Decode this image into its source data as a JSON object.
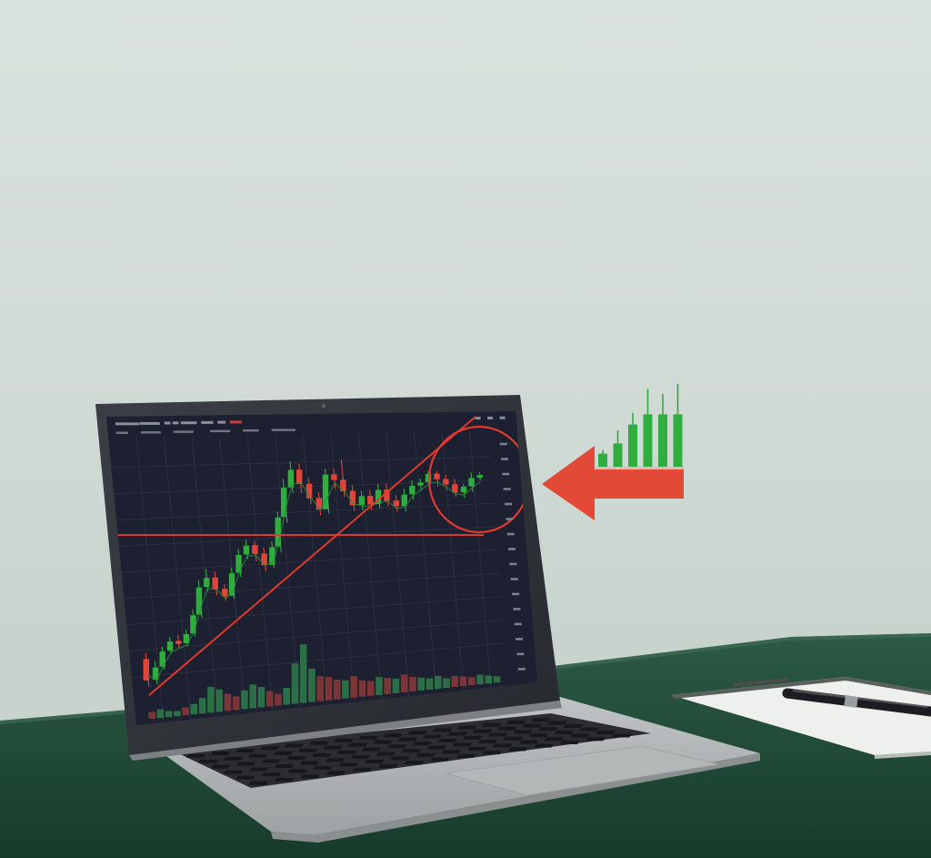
{
  "scene": {
    "wall_color": "#d4ddd7",
    "desk_color": "#1f4a36",
    "laptop_color": "#a9adae",
    "screen_bg": "#1e2231"
  },
  "chart_data": {
    "type": "candlestick",
    "up_color": "#2fae3f",
    "down_color": "#e0453a",
    "annotation_color": "#e03a2e",
    "candles": [
      {
        "o": 36,
        "c": 22,
        "h": 40,
        "l": 18
      },
      {
        "o": 22,
        "c": 30,
        "h": 34,
        "l": 19
      },
      {
        "o": 30,
        "c": 40,
        "h": 43,
        "l": 28
      },
      {
        "o": 40,
        "c": 46,
        "h": 49,
        "l": 38
      },
      {
        "o": 46,
        "c": 44,
        "h": 50,
        "l": 41
      },
      {
        "o": 44,
        "c": 50,
        "h": 53,
        "l": 42
      },
      {
        "o": 50,
        "c": 62,
        "h": 66,
        "l": 48
      },
      {
        "o": 62,
        "c": 80,
        "h": 85,
        "l": 60
      },
      {
        "o": 80,
        "c": 86,
        "h": 92,
        "l": 77
      },
      {
        "o": 86,
        "c": 78,
        "h": 90,
        "l": 74
      },
      {
        "o": 78,
        "c": 73,
        "h": 81,
        "l": 70
      },
      {
        "o": 73,
        "c": 88,
        "h": 92,
        "l": 71
      },
      {
        "o": 88,
        "c": 100,
        "h": 104,
        "l": 85
      },
      {
        "o": 100,
        "c": 106,
        "h": 110,
        "l": 97
      },
      {
        "o": 106,
        "c": 100,
        "h": 109,
        "l": 95
      },
      {
        "o": 100,
        "c": 92,
        "h": 104,
        "l": 88
      },
      {
        "o": 92,
        "c": 104,
        "h": 108,
        "l": 90
      },
      {
        "o": 104,
        "c": 124,
        "h": 128,
        "l": 100
      },
      {
        "o": 124,
        "c": 144,
        "h": 150,
        "l": 120
      },
      {
        "o": 144,
        "c": 156,
        "h": 162,
        "l": 140
      },
      {
        "o": 156,
        "c": 146,
        "h": 160,
        "l": 140
      },
      {
        "o": 146,
        "c": 136,
        "h": 150,
        "l": 132
      },
      {
        "o": 136,
        "c": 128,
        "h": 140,
        "l": 124
      },
      {
        "o": 128,
        "c": 152,
        "h": 156,
        "l": 125
      },
      {
        "o": 152,
        "c": 148,
        "h": 156,
        "l": 142
      },
      {
        "o": 148,
        "c": 140,
        "h": 162,
        "l": 136
      },
      {
        "o": 140,
        "c": 130,
        "h": 144,
        "l": 126
      },
      {
        "o": 130,
        "c": 136,
        "h": 140,
        "l": 126
      },
      {
        "o": 136,
        "c": 130,
        "h": 140,
        "l": 126
      },
      {
        "o": 130,
        "c": 140,
        "h": 144,
        "l": 127
      },
      {
        "o": 140,
        "c": 132,
        "h": 144,
        "l": 128
      },
      {
        "o": 132,
        "c": 128,
        "h": 136,
        "l": 124
      },
      {
        "o": 128,
        "c": 136,
        "h": 140,
        "l": 124
      },
      {
        "o": 136,
        "c": 142,
        "h": 146,
        "l": 132
      },
      {
        "o": 142,
        "c": 144,
        "h": 147,
        "l": 138
      },
      {
        "o": 144,
        "c": 150,
        "h": 152,
        "l": 140
      },
      {
        "o": 150,
        "c": 146,
        "h": 152,
        "l": 141
      },
      {
        "o": 146,
        "c": 142,
        "h": 149,
        "l": 138
      },
      {
        "o": 142,
        "c": 136,
        "h": 146,
        "l": 133
      },
      {
        "o": 136,
        "c": 140,
        "h": 142,
        "l": 132
      },
      {
        "o": 140,
        "c": 146,
        "h": 150,
        "l": 136
      },
      {
        "o": 146,
        "c": 148,
        "h": 150,
        "l": 144
      }
    ],
    "volume": [
      8,
      10,
      7,
      6,
      9,
      12,
      18,
      30,
      26,
      20,
      16,
      22,
      28,
      24,
      18,
      14,
      20,
      48,
      70,
      40,
      30,
      28,
      24,
      22,
      26,
      20,
      18,
      22,
      20,
      18,
      22,
      18,
      16,
      14,
      16,
      12,
      14,
      12,
      10,
      12,
      10,
      8
    ],
    "icon_bars": [
      {
        "v": 0.18,
        "wick": 0.05,
        "up": true
      },
      {
        "v": 0.32,
        "wick": 0.18,
        "up": true
      },
      {
        "v": 0.58,
        "wick": 0.16,
        "up": true
      },
      {
        "v": 0.72,
        "wick": 0.35,
        "up": true
      },
      {
        "v": 0.72,
        "wick": 0.28,
        "up": true
      },
      {
        "v": 0.72,
        "wick": 0.42,
        "up": true
      }
    ]
  }
}
